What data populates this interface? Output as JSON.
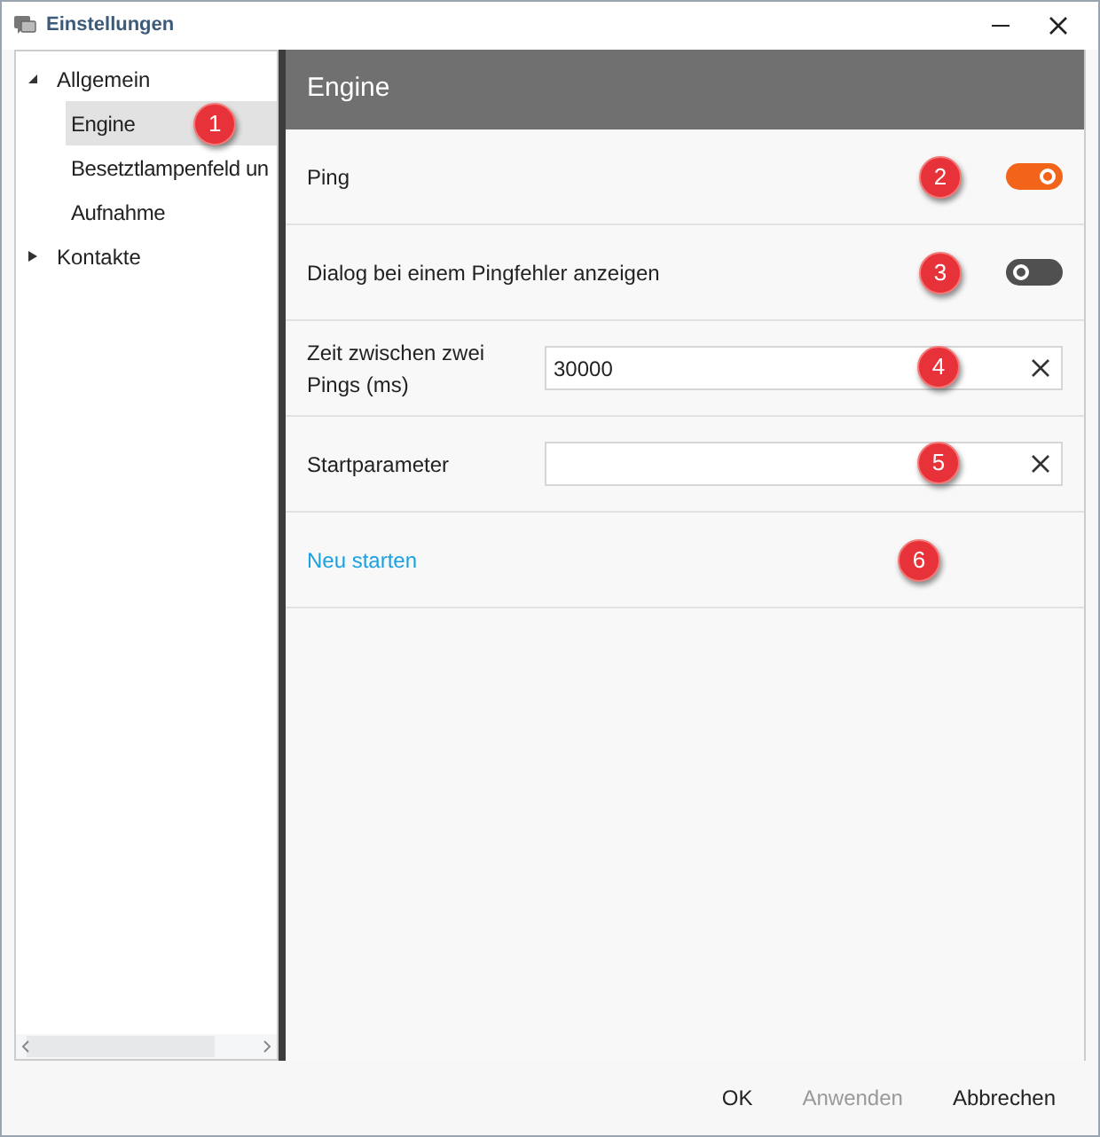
{
  "window": {
    "title": "Einstellungen"
  },
  "tree": [
    {
      "label": "Allgemein",
      "expanded": true,
      "selected": false,
      "children": [
        {
          "label": "Engine",
          "selected": true,
          "callout": "1"
        },
        {
          "label": "Besetztlampenfeld un",
          "selected": false
        },
        {
          "label": "Aufnahme",
          "selected": false
        }
      ]
    },
    {
      "label": "Kontakte",
      "expanded": false,
      "selected": false
    }
  ],
  "panel": {
    "title": "Engine",
    "rows": [
      {
        "kind": "switch",
        "label": "Ping",
        "on": true,
        "callout": "2"
      },
      {
        "kind": "switch",
        "label": "Dialog bei einem Pingfehler anzeigen",
        "on": false,
        "callout": "3"
      },
      {
        "kind": "field",
        "label": "Zeit zwischen zwei Pings (ms)",
        "value": "30000",
        "callout": "4"
      },
      {
        "kind": "field",
        "label": "Startparameter",
        "callout": "5"
      },
      {
        "kind": "link",
        "label": "Neu starten",
        "callout": "6"
      }
    ]
  },
  "buttons": [
    {
      "label": "OK",
      "disabled": false
    },
    {
      "label": "Anwenden",
      "disabled": true
    },
    {
      "label": "Abbrechen",
      "disabled": false
    }
  ]
}
